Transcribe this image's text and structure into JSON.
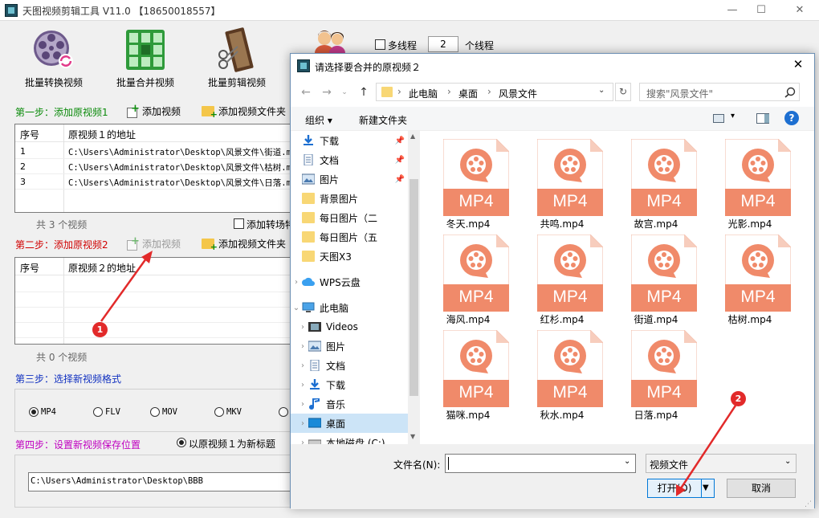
{
  "window": {
    "title": "天图视频剪辑工具 V11.0 【18650018557】",
    "minimize": "—",
    "maximize": "☐",
    "close": "✕"
  },
  "toolbar": {
    "batch_convert": "批量转换视频",
    "batch_merge": "批量合并视频",
    "batch_cut": "批量剪辑视频",
    "multithread_label": "多线程",
    "thread_count": "2",
    "thread_unit": "个线程"
  },
  "step1": {
    "label": "第一步：添加原视频1",
    "add_video": "添加视频",
    "add_folder": "添加视频文件夹",
    "col_index": "序号",
    "col_path": "原视频１的地址",
    "rows": [
      {
        "index": "1",
        "path": "C:\\Users\\Administrator\\Desktop\\风景文件\\街道.m"
      },
      {
        "index": "2",
        "path": "C:\\Users\\Administrator\\Desktop\\风景文件\\枯树.m"
      },
      {
        "index": "3",
        "path": "C:\\Users\\Administrator\\Desktop\\风景文件\\日落.m"
      }
    ],
    "count": "共 3 个视频",
    "add_transition": "添加转场特"
  },
  "step2": {
    "label": "第二步：添加原视频2",
    "add_video": "添加视频",
    "add_folder": "添加视频文件夹",
    "col_index": "序号",
    "col_path": "原视频２的地址",
    "count": "共 0 个视频"
  },
  "step3": {
    "label": "第三步：选择新视频格式",
    "formats": [
      "MP4",
      "FLV",
      "MOV",
      "MKV"
    ],
    "selected": "MP4"
  },
  "step4": {
    "label": "第四步：设置新视频保存位置",
    "title_option": "以原视频１为新标题",
    "save_path": "C:\\Users\\Administrator\\Desktop\\BBB"
  },
  "dialog": {
    "title": "请选择要合并的原视频２",
    "breadcrumb": [
      "此电脑",
      "桌面",
      "风景文件"
    ],
    "search_placeholder": "搜索\"风景文件\"",
    "organize": "组织 ▾",
    "new_folder": "新建文件夹",
    "tree": {
      "quick": [
        {
          "label": "下载",
          "icon": "download-icon",
          "pinned": true
        },
        {
          "label": "文档",
          "icon": "document-icon",
          "pinned": true
        },
        {
          "label": "图片",
          "icon": "picture-icon",
          "pinned": true
        },
        {
          "label": "背景图片",
          "icon": "folder-icon",
          "pinned": false
        },
        {
          "label": "每日图片（二",
          "icon": "folder-icon",
          "pinned": false
        },
        {
          "label": "每日图片（五",
          "icon": "folder-icon",
          "pinned": false
        },
        {
          "label": "天图X3",
          "icon": "folder-icon",
          "pinned": false
        }
      ],
      "wps": "WPS云盘",
      "this_pc": "此电脑",
      "pc_items": [
        {
          "label": "Videos",
          "icon": "video-icon"
        },
        {
          "label": "图片",
          "icon": "picture-icon"
        },
        {
          "label": "文档",
          "icon": "document-icon"
        },
        {
          "label": "下载",
          "icon": "download-icon"
        },
        {
          "label": "音乐",
          "icon": "music-icon"
        },
        {
          "label": "桌面",
          "icon": "desktop-icon",
          "selected": true
        },
        {
          "label": "本地磁盘 (C:)",
          "icon": "disk-icon"
        }
      ]
    },
    "files": [
      "冬天.mp4",
      "共鸣.mp4",
      "故宫.mp4",
      "光影.mp4",
      "海风.mp4",
      "红杉.mp4",
      "街道.mp4",
      "枯树.mp4",
      "猫咪.mp4",
      "秋水.mp4",
      "日落.mp4"
    ],
    "file_badge": "MP4",
    "filename_label": "文件名(N):",
    "filename_value": "",
    "filetype": "视频文件",
    "open_button": "打开(O)",
    "cancel_button": "取消"
  },
  "annotations": {
    "callout1": "1",
    "callout2": "2"
  },
  "colors": {
    "mp4_orange": "#f08a6a",
    "callout_red": "#e22a2a",
    "step1_green": "#0a8a0a",
    "step2_red": "#d00000",
    "step3_blue": "#1030c0",
    "step4_magenta": "#c000c0"
  }
}
